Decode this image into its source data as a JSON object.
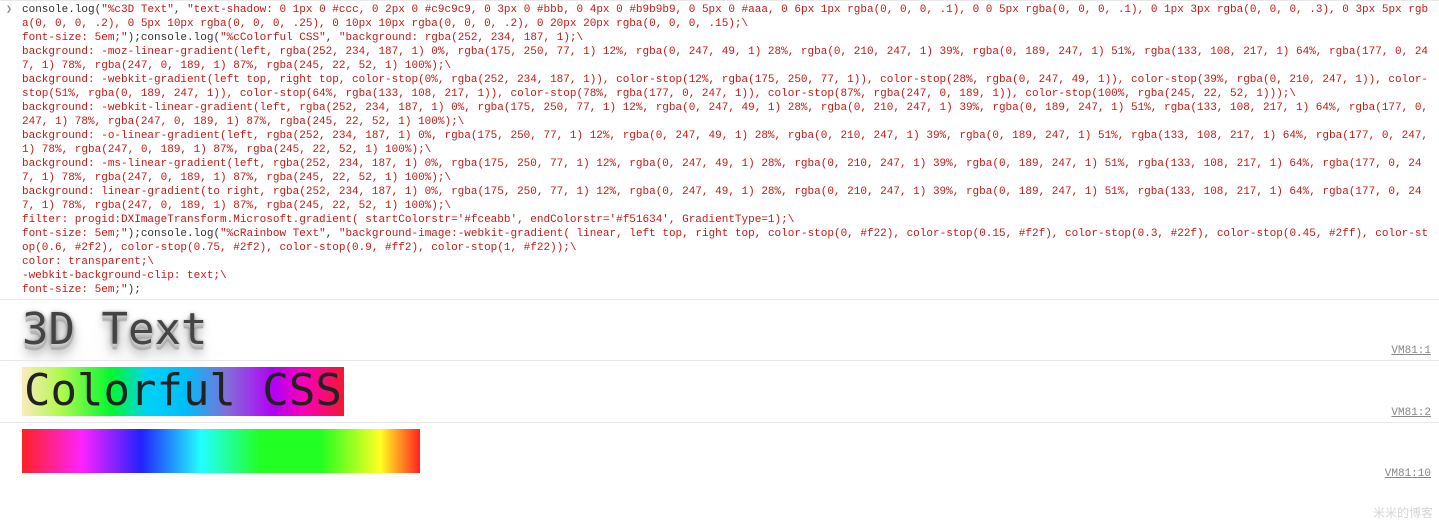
{
  "input": {
    "parts": {
      "p0": "console",
      "p1": ".log(",
      "s0": "\"%c3D Text\"",
      "c0": ", ",
      "s1": "\"text-shadow: 0 1px 0 #ccc, 0 2px 0 #c9c9c9, 0 3px 0 #bbb, 0 4px 0 #b9b9b9, 0 5px 0 #aaa, 0 6px 1px rgba(0, 0, 0, .1), 0 0 5px rgba(0, 0, 0, .1), 0 1px 3px rgba(0, 0, 0, .3), 0 3px 5px rgba(0, 0, 0, .2), 0 5px 10px rgba(0, 0, 0, .25), 0 10px 10px rgba(0, 0, 0, .2), 0 20px 20px rgba(0, 0, 0, .15);\\\nfont-size: 5em;\"",
      "p2": ");console",
      "p3": ".log(",
      "s2": "\"%cColorful CSS\"",
      "c1": ", ",
      "s3": "\"background: rgba(252, 234, 187, 1);\\\nbackground: -moz-linear-gradient(left, rgba(252, 234, 187, 1) 0%, rgba(175, 250, 77, 1) 12%, rgba(0, 247, 49, 1) 28%, rgba(0, 210, 247, 1) 39%, rgba(0, 189, 247, 1) 51%, rgba(133, 108, 217, 1) 64%, rgba(177, 0, 247, 1) 78%, rgba(247, 0, 189, 1) 87%, rgba(245, 22, 52, 1) 100%);\\\nbackground: -webkit-gradient(left top, right top, color-stop(0%, rgba(252, 234, 187, 1)), color-stop(12%, rgba(175, 250, 77, 1)), color-stop(28%, rgba(0, 247, 49, 1)), color-stop(39%, rgba(0, 210, 247, 1)), color-stop(51%, rgba(0, 189, 247, 1)), color-stop(64%, rgba(133, 108, 217, 1)), color-stop(78%, rgba(177, 0, 247, 1)), color-stop(87%, rgba(247, 0, 189, 1)), color-stop(100%, rgba(245, 22, 52, 1)));\\\nbackground: -webkit-linear-gradient(left, rgba(252, 234, 187, 1) 0%, rgba(175, 250, 77, 1) 12%, rgba(0, 247, 49, 1) 28%, rgba(0, 210, 247, 1) 39%, rgba(0, 189, 247, 1) 51%, rgba(133, 108, 217, 1) 64%, rgba(177, 0, 247, 1) 78%, rgba(247, 0, 189, 1) 87%, rgba(245, 22, 52, 1) 100%);\\\nbackground: -o-linear-gradient(left, rgba(252, 234, 187, 1) 0%, rgba(175, 250, 77, 1) 12%, rgba(0, 247, 49, 1) 28%, rgba(0, 210, 247, 1) 39%, rgba(0, 189, 247, 1) 51%, rgba(133, 108, 217, 1) 64%, rgba(177, 0, 247, 1) 78%, rgba(247, 0, 189, 1) 87%, rgba(245, 22, 52, 1) 100%);\\\nbackground: -ms-linear-gradient(left, rgba(252, 234, 187, 1) 0%, rgba(175, 250, 77, 1) 12%, rgba(0, 247, 49, 1) 28%, rgba(0, 210, 247, 1) 39%, rgba(0, 189, 247, 1) 51%, rgba(133, 108, 217, 1) 64%, rgba(177, 0, 247, 1) 78%, rgba(247, 0, 189, 1) 87%, rgba(245, 22, 52, 1) 100%);\\\nbackground: linear-gradient(to right, rgba(252, 234, 187, 1) 0%, rgba(175, 250, 77, 1) 12%, rgba(0, 247, 49, 1) 28%, rgba(0, 210, 247, 1) 39%, rgba(0, 189, 247, 1) 51%, rgba(133, 108, 217, 1) 64%, rgba(177, 0, 247, 1) 78%, rgba(247, 0, 189, 1) 87%, rgba(245, 22, 52, 1) 100%);\\\nfilter: progid:DXImageTransform.Microsoft.gradient( startColorstr='#fceabb', endColorstr='#f51634', GradientType=1);\\\nfont-size: 5em;\"",
      "p4": ");console",
      "p5": ".log(",
      "s4": "\"%cRainbow Text\"",
      "c2": ", ",
      "s5": "\"background-image:-webkit-gradient( linear, left top, right top, color-stop(0, #f22), color-stop(0.15, #f2f), color-stop(0.3, #22f), color-stop(0.45, #2ff), color-stop(0.6, #2f2), color-stop(0.75, #2f2), color-stop(0.9, #ff2), color-stop(1, #f22));\\\ncolor: transparent;\\\n-webkit-background-clip: text;\\\nfont-size: 5em;\"",
      "p6": ");"
    }
  },
  "outputs": {
    "o1_text": "3D Text",
    "o1_src": "VM81:1",
    "o2_text": "Colorful CSS",
    "o2_src": "VM81:2",
    "o3_src": "VM81:10"
  },
  "watermark": "米米的博客"
}
